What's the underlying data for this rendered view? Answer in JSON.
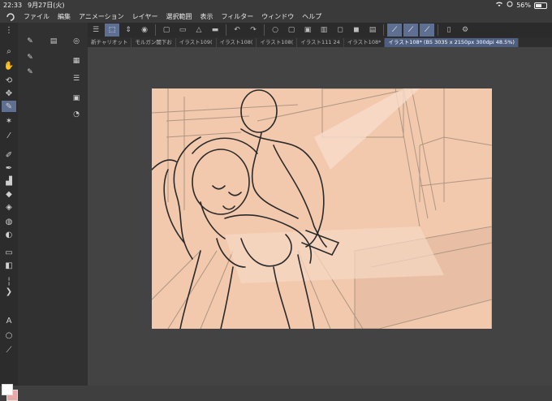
{
  "status_bar": {
    "time": "22:33",
    "date": "9月27日(火)",
    "battery": "56%",
    "battery_level": 0.56
  },
  "menu": {
    "items": [
      "ファイル",
      "編集",
      "アニメーション",
      "レイヤー",
      "選択範囲",
      "表示",
      "フィルター",
      "ウィンドウ",
      "ヘルプ"
    ]
  },
  "tabs": [
    {
      "label": "新チャリオット",
      "active": false
    },
    {
      "label": "モルガン闇下お",
      "active": false
    },
    {
      "label": "イラスト109(",
      "active": false
    },
    {
      "label": "イラスト108(",
      "active": false
    },
    {
      "label": "イラスト108(",
      "active": false
    },
    {
      "label": "イラスト111 24",
      "active": false
    },
    {
      "label": "イラスト108*",
      "active": false
    },
    {
      "label": "イラスト108* (B5 3035 x 2150px 300dpi 48.5%)",
      "active": true
    }
  ],
  "colors": {
    "background": "#3f3f3f",
    "accent": "#5f6f92",
    "canvas_paper": "#f2c9ad",
    "sketch_line": "#2a2a2a"
  },
  "icons": {
    "toolbar": [
      "menu-icon",
      "select-icon",
      "lasso-icon",
      "record-icon",
      "new-file-icon",
      "open-file-icon",
      "save-icon",
      "undo-icon",
      "redo-icon",
      "circle-icon",
      "clear-icon",
      "fill-icon",
      "transform-icon",
      "deselect-icon",
      "invert-icon",
      "snap-off-icon",
      "ruler-snap-icon",
      "perspective-icon",
      "grid-icon",
      "phone-icon",
      "settings-icon"
    ],
    "tools": [
      "zoom-icon",
      "hand-icon",
      "rotate-icon",
      "move-icon",
      "pen-icon",
      "magic-wand-icon",
      "eyedropper-icon",
      "pencil-icon",
      "brush-icon",
      "airbrush-icon",
      "blend-icon",
      "eraser-icon",
      "fill-bucket-icon",
      "gradient-icon",
      "figure-icon",
      "frame-icon",
      "text-icon",
      "balloon-icon",
      "line-icon"
    ]
  }
}
